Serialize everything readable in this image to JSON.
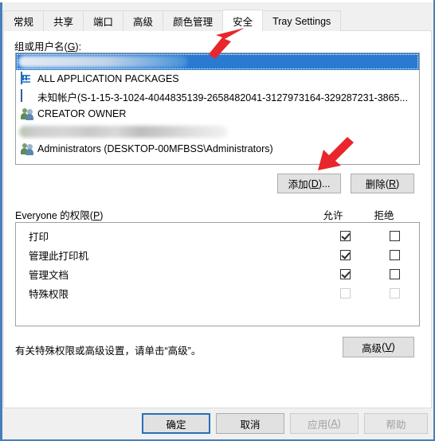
{
  "window": {
    "title": "Printer Properties - Security",
    "accent_color": "#2a7ad2",
    "annotation_color": "#e8262c"
  },
  "tabs": [
    {
      "label": "常规",
      "active": false
    },
    {
      "label": "共享",
      "active": false
    },
    {
      "label": "端口",
      "active": false
    },
    {
      "label": "高级",
      "active": false
    },
    {
      "label": "颜色管理",
      "active": false
    },
    {
      "label": "安全",
      "active": true
    },
    {
      "label": "Tray Settings",
      "active": false
    }
  ],
  "security": {
    "group_label_text": "组或用户名",
    "group_label_accel": "G",
    "group_label_suffix": ":",
    "users": [
      {
        "name": "",
        "icon": "redacted-name-icon",
        "selected": true,
        "redacted": true
      },
      {
        "name": "ALL APPLICATION PACKAGES",
        "icon": "app-package-icon",
        "selected": false,
        "redacted": false
      },
      {
        "name": "未知帐户(S-1-15-3-1024-4044835139-2658482041-3127973164-329287231-3865...",
        "icon": "unknown-account-icon",
        "selected": false,
        "redacted": false
      },
      {
        "name": "CREATOR OWNER",
        "icon": "user-group-icon",
        "selected": false,
        "redacted": false
      },
      {
        "name": "",
        "icon": "redacted-name-icon",
        "selected": false,
        "redacted": true
      },
      {
        "name": "Administrators (DESKTOP-00MFBSS\\Administrators)",
        "icon": "user-group-icon",
        "selected": false,
        "redacted": false
      }
    ],
    "add_button": {
      "text": "添加",
      "accel": "D",
      "suffix": "...",
      "enabled": true
    },
    "remove_button": {
      "text": "删除",
      "accel": "R",
      "suffix": "",
      "enabled": true
    }
  },
  "permissions": {
    "label_prefix": "Everyone 的权限",
    "label_accel": "P",
    "allow_header": "允许",
    "deny_header": "拒绝",
    "rows": [
      {
        "name": "打印",
        "allow": true,
        "deny": false,
        "enabled": true
      },
      {
        "name": "管理此打印机",
        "allow": true,
        "deny": false,
        "enabled": true
      },
      {
        "name": "管理文档",
        "allow": true,
        "deny": false,
        "enabled": true
      },
      {
        "name": "特殊权限",
        "allow": false,
        "deny": false,
        "enabled": false
      }
    ]
  },
  "advanced": {
    "hint_text": "有关特殊权限或高级设置，请单击“高级”。",
    "button": {
      "text": "高级",
      "accel": "V",
      "enabled": true
    }
  },
  "footer": {
    "ok": {
      "text": "确定",
      "accel": "",
      "enabled": true,
      "default": true
    },
    "cancel": {
      "text": "取消",
      "accel": "",
      "enabled": true,
      "default": false
    },
    "apply": {
      "text": "应用",
      "accel": "A",
      "enabled": false,
      "default": false
    },
    "help": {
      "text": "帮助",
      "accel": "",
      "enabled": false,
      "default": false
    }
  },
  "annotations": [
    {
      "name": "arrow-pointing-to-security-tab",
      "direction": "up-right"
    },
    {
      "name": "arrow-pointing-to-add-button",
      "direction": "down-left"
    }
  ]
}
